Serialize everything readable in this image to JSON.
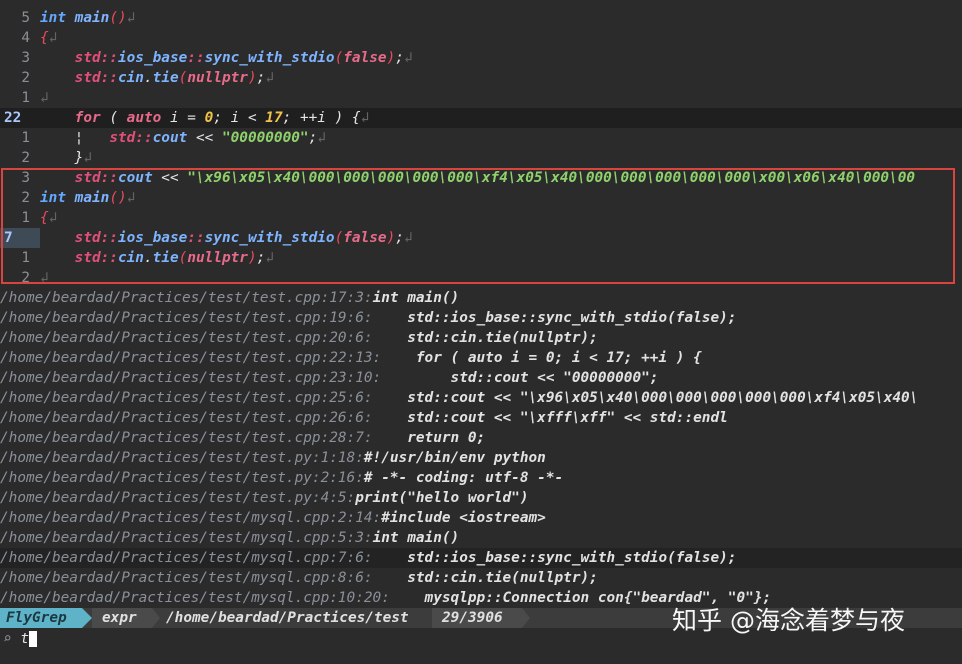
{
  "editor": {
    "lines": [
      {
        "num": "5",
        "tokens": [
          [
            "kw",
            "int"
          ],
          [
            "code",
            " "
          ],
          [
            "fn",
            "main"
          ],
          [
            "par",
            "()"
          ],
          [
            "eol",
            "↲"
          ]
        ]
      },
      {
        "num": "4",
        "tokens": [
          [
            "par",
            "{"
          ],
          [
            "eol",
            "↲"
          ]
        ]
      },
      {
        "num": "3",
        "tokens": [
          [
            "code",
            "    "
          ],
          [
            "ns",
            "std::"
          ],
          [
            "fn",
            "ios_base"
          ],
          [
            "ns",
            "::"
          ],
          [
            "fn",
            "sync_with_stdio"
          ],
          [
            "par",
            "("
          ],
          [
            "kw2",
            "false"
          ],
          [
            "par",
            ")"
          ],
          [
            "code",
            ";"
          ],
          [
            "eol",
            "↲"
          ]
        ]
      },
      {
        "num": "2",
        "tokens": [
          [
            "code",
            "    "
          ],
          [
            "ns",
            "std::"
          ],
          [
            "fn",
            "cin"
          ],
          [
            "code",
            "."
          ],
          [
            "fn",
            "tie"
          ],
          [
            "par",
            "("
          ],
          [
            "kw2",
            "nullptr"
          ],
          [
            "par",
            ")"
          ],
          [
            "code",
            ";"
          ],
          [
            "eol",
            "↲"
          ]
        ]
      },
      {
        "num": "1",
        "tokens": [
          [
            "eol",
            "↲"
          ]
        ]
      },
      {
        "num": "22",
        "current": true,
        "tokens": [
          [
            "code",
            "    "
          ],
          [
            "kw2",
            "for"
          ],
          [
            "code",
            " ( "
          ],
          [
            "kw2",
            "auto"
          ],
          [
            "code",
            " i = "
          ],
          [
            "num",
            "0"
          ],
          [
            "code",
            "; i < "
          ],
          [
            "num",
            "17"
          ],
          [
            "code",
            "; ++i ) {"
          ],
          [
            "eol",
            "↲"
          ]
        ]
      },
      {
        "num": "1",
        "tokens": [
          [
            "code",
            "    ¦   "
          ],
          [
            "ns",
            "std::"
          ],
          [
            "fn",
            "cout"
          ],
          [
            "code",
            " << "
          ],
          [
            "str",
            "\"00000000\""
          ],
          [
            "code",
            ";"
          ],
          [
            "eol",
            "↲"
          ]
        ]
      },
      {
        "num": "2",
        "tokens": [
          [
            "code",
            "    }"
          ],
          [
            "eol",
            "↲"
          ]
        ]
      },
      {
        "num": "3",
        "tokens": [
          [
            "code",
            "    "
          ],
          [
            "ns",
            "std::"
          ],
          [
            "fn",
            "cout"
          ],
          [
            "code",
            " << "
          ],
          [
            "str",
            "\"\\x96\\x05\\x40\\000\\000\\000\\000\\000\\xf4\\x05\\x40\\000\\000\\000\\000\\000\\x00\\x06\\x40\\000\\00"
          ]
        ]
      },
      {
        "num": "2",
        "tokens": [
          [
            "kw",
            "int"
          ],
          [
            "code",
            " "
          ],
          [
            "fn",
            "main"
          ],
          [
            "par",
            "()"
          ],
          [
            "eol",
            "↲"
          ]
        ]
      },
      {
        "num": "1",
        "tokens": [
          [
            "par",
            "{"
          ],
          [
            "eol",
            "↲"
          ]
        ]
      },
      {
        "num": "7",
        "marker": true,
        "tokens": [
          [
            "code",
            "    "
          ],
          [
            "ns",
            "std::"
          ],
          [
            "fn",
            "ios_base"
          ],
          [
            "ns",
            "::"
          ],
          [
            "fn",
            "sync_with_stdio"
          ],
          [
            "par",
            "("
          ],
          [
            "kw2",
            "false"
          ],
          [
            "par",
            ")"
          ],
          [
            "code",
            ";"
          ],
          [
            "eol",
            "↲"
          ]
        ]
      },
      {
        "num": "1",
        "tokens": [
          [
            "code",
            "    "
          ],
          [
            "ns",
            "std::"
          ],
          [
            "fn",
            "cin"
          ],
          [
            "code",
            "."
          ],
          [
            "fn",
            "tie"
          ],
          [
            "par",
            "("
          ],
          [
            "kw2",
            "nullptr"
          ],
          [
            "par",
            ")"
          ],
          [
            "code",
            ";"
          ],
          [
            "eol",
            "↲"
          ]
        ]
      },
      {
        "num": "2",
        "tokens": [
          [
            "eol",
            "↲"
          ]
        ]
      }
    ]
  },
  "results": [
    {
      "path": "/home/beardad/Practices/test/test.cpp:17:3:",
      "body": "int main()"
    },
    {
      "path": "/home/beardad/Practices/test/test.cpp:19:6:",
      "body": "    std::ios_base::sync_with_stdio(false);"
    },
    {
      "path": "/home/beardad/Practices/test/test.cpp:20:6:",
      "body": "    std::cin.tie(nullptr);"
    },
    {
      "path": "/home/beardad/Practices/test/test.cpp:22:13:",
      "body": "    for ( auto i = 0; i < 17; ++i ) {"
    },
    {
      "path": "/home/beardad/Practices/test/test.cpp:23:10:",
      "body": "        std::cout << \"00000000\";"
    },
    {
      "path": "/home/beardad/Practices/test/test.cpp:25:6:",
      "body": "    std::cout << \"\\x96\\x05\\x40\\000\\000\\000\\000\\000\\xf4\\x05\\x40\\"
    },
    {
      "path": "/home/beardad/Practices/test/test.cpp:26:6:",
      "body": "    std::cout << \"\\xfff\\xff\" << std::endl"
    },
    {
      "path": "/home/beardad/Practices/test/test.cpp:28:7:",
      "body": "    return 0;"
    },
    {
      "path": "/home/beardad/Practices/test/test.py:1:18:",
      "body": "#!/usr/bin/env python"
    },
    {
      "path": "/home/beardad/Practices/test/test.py:2:16:",
      "body": "# -*- coding: utf-8 -*-"
    },
    {
      "path": "/home/beardad/Practices/test/test.py:4:5:",
      "body": "print(\"hello world\")"
    },
    {
      "path": "/home/beardad/Practices/test/mysql.cpp:2:14:",
      "body": "#include <iostream>"
    },
    {
      "path": "/home/beardad/Practices/test/mysql.cpp:5:3:",
      "body": "int main()"
    },
    {
      "path": "/home/beardad/Practices/test/mysql.cpp:7:6:",
      "body": "    std::ios_base::sync_with_stdio(false);",
      "selected": true
    },
    {
      "path": "/home/beardad/Practices/test/mysql.cpp:8:6:",
      "body": "    std::cin.tie(nullptr);"
    },
    {
      "path": "/home/beardad/Practices/test/mysql.cpp:10:20:",
      "body": "    mysqlpp::Connection con{\"beardad\", \"0\"};"
    }
  ],
  "status": {
    "mode": "FlyGrep",
    "expr": "expr",
    "path": "/home/beardad/Practices/test",
    "count": "29/3906"
  },
  "prompt": {
    "symbol": "⌕",
    "input": "t"
  },
  "watermark": "知乎 @海念着梦与夜",
  "colors": {
    "highlight_box": "#d8443e",
    "mode_bg": "#5fb3c8"
  }
}
